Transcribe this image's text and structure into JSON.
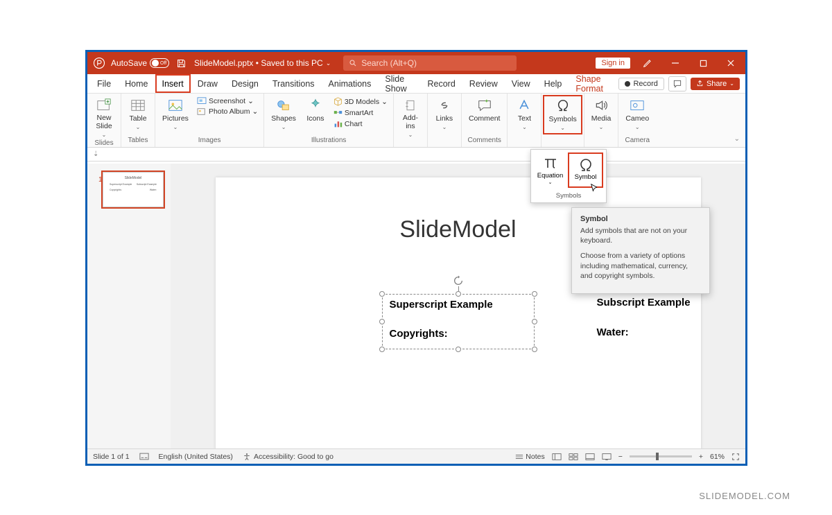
{
  "titlebar": {
    "autosave": "AutoSave",
    "toggle_state": "Off",
    "filename": "SlideModel.pptx",
    "save_status": "Saved to this PC",
    "search_placeholder": "Search (Alt+Q)",
    "signin": "Sign in"
  },
  "menu": {
    "tabs": [
      "File",
      "Home",
      "Insert",
      "Draw",
      "Design",
      "Transitions",
      "Animations",
      "Slide Show",
      "Record",
      "Review",
      "View",
      "Help",
      "Shape Format"
    ],
    "active": "Insert",
    "record": "Record",
    "share": "Share"
  },
  "ribbon": {
    "new_slide": "New\nSlide",
    "slides_label": "Slides",
    "table": "Table",
    "tables_label": "Tables",
    "pictures": "Pictures",
    "screenshot": "Screenshot",
    "photo_album": "Photo Album",
    "images_label": "Images",
    "shapes": "Shapes",
    "icons": "Icons",
    "models": "3D Models",
    "smartart": "SmartArt",
    "chart": "Chart",
    "illustrations_label": "Illustrations",
    "addins": "Add-\nins",
    "links": "Links",
    "comment": "Comment",
    "comments_label": "Comments",
    "text": "Text",
    "symbols": "Symbols",
    "media": "Media",
    "cameo": "Cameo",
    "camera_label": "Camera"
  },
  "symbols_dropdown": {
    "equation": "Equation",
    "symbol": "Symbol",
    "group_label": "Symbols"
  },
  "tooltip": {
    "title": "Symbol",
    "p1": "Add symbols that are not on your keyboard.",
    "p2": "Choose from a variety of options including mathematical, currency, and copyright symbols."
  },
  "slide": {
    "title": "SlideModel",
    "superscript_heading": "Superscript Example",
    "superscript_value": "Copyrights:",
    "subscript_heading": "Subscript Example",
    "subscript_value": "Water:"
  },
  "thumb": {
    "number": "1",
    "title": "SlideModel",
    "l1a": "Superscript Example",
    "l1b": "Subscript Example",
    "l2a": "Copyrights:",
    "l2b": "Water:"
  },
  "statusbar": {
    "slide": "Slide 1 of 1",
    "lang": "English (United States)",
    "access": "Accessibility: Good to go",
    "notes": "Notes",
    "zoom": "61%"
  },
  "watermark": "SLIDEMODEL.COM"
}
